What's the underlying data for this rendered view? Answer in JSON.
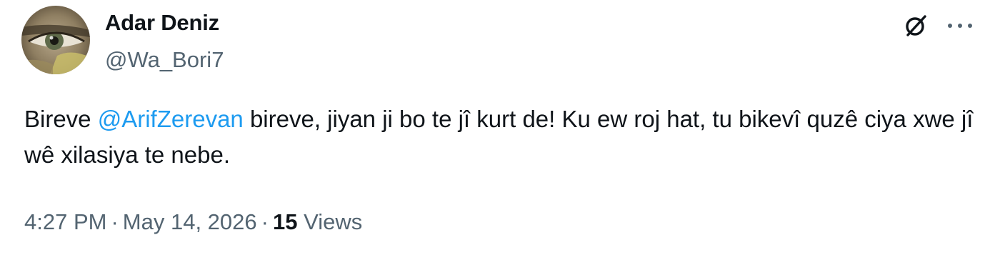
{
  "author": {
    "display_name": "Adar Deniz",
    "handle": "@Wa_Bori7"
  },
  "tweet": {
    "text_before": "Bireve ",
    "mention": "@ArifZerevan",
    "text_after": " bireve, jiyan ji bo te jî kurt de! Ku ew roj hat, tu bikevî quzê ciya xwe jî wê xilasiya te nebe."
  },
  "meta": {
    "time": "4:27 PM",
    "separator": "·",
    "date": "May 14, 2026",
    "views_count": "15",
    "views_label": "Views"
  },
  "icons": {
    "grok": "grok-slash-circle-icon",
    "more": "more-horizontal-icon"
  },
  "colors": {
    "text": "#0f1419",
    "secondary": "#536471",
    "link": "#1d9bf0",
    "background": "#ffffff"
  }
}
